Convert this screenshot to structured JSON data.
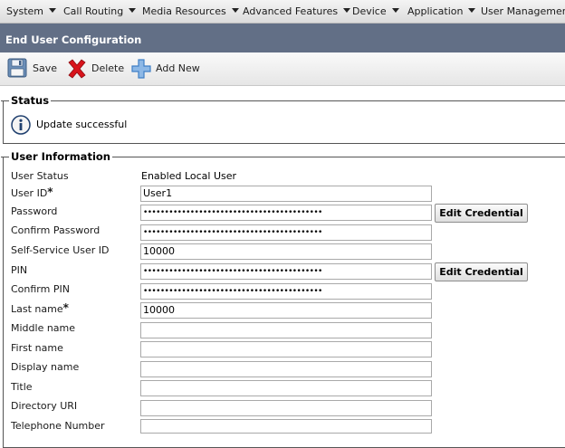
{
  "menu": {
    "items": [
      {
        "label": "System"
      },
      {
        "label": "Call Routing"
      },
      {
        "label": "Media Resources"
      },
      {
        "label": "Advanced Features"
      },
      {
        "label": "Device"
      },
      {
        "label": "Application"
      },
      {
        "label": "User Management"
      }
    ]
  },
  "header": {
    "title": "End User Configuration"
  },
  "toolbar": {
    "save_label": "Save",
    "delete_label": "Delete",
    "add_new_label": "Add New"
  },
  "status": {
    "legend": "Status",
    "message": "Update successful"
  },
  "user_info": {
    "legend": "User Information",
    "user_status": {
      "label": "User Status",
      "value": "Enabled Local User"
    },
    "user_id": {
      "label": "User ID",
      "required": "*",
      "value": "User1"
    },
    "password": {
      "label": "Password",
      "value": "••••••••••••••••••••••••••••••••••••••••••"
    },
    "confirm_password": {
      "label": "Confirm Password",
      "value": "••••••••••••••••••••••••••••••••••••••••••"
    },
    "self_service_id": {
      "label": "Self-Service User ID",
      "value": "10000"
    },
    "pin": {
      "label": "PIN",
      "value": "••••••••••••••••••••••••••••••••••••••••••"
    },
    "confirm_pin": {
      "label": "Confirm PIN",
      "value": "••••••••••••••••••••••••••••••••••••••••••"
    },
    "last_name": {
      "label": "Last name",
      "required": "*",
      "value": "10000"
    },
    "middle_name": {
      "label": "Middle name",
      "value": ""
    },
    "first_name": {
      "label": "First name",
      "value": ""
    },
    "display_name": {
      "label": "Display name",
      "value": ""
    },
    "title": {
      "label": "Title",
      "value": ""
    },
    "directory_uri": {
      "label": "Directory URI",
      "value": ""
    },
    "telephone_number": {
      "label": "Telephone Number",
      "value": ""
    },
    "edit_credential_label": "Edit Credential"
  },
  "icons": {
    "save": "floppy-disk-icon",
    "delete": "red-x-icon",
    "add_new": "blue-plus-icon",
    "status": "info-icon",
    "menu_caret": "chevron-down-icon"
  },
  "colors": {
    "title_bar": "#626f86",
    "delete_red": "#d8141c",
    "add_blue": "#3f7fc6"
  }
}
